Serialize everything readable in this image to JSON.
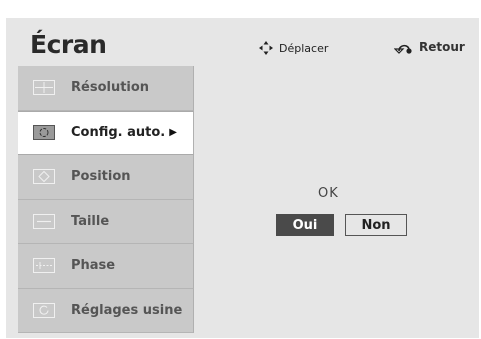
{
  "header": {
    "title": "Écran",
    "move_hint": "Déplacer",
    "move_icon": "four-way-arrows-icon",
    "back_hint": "Retour",
    "back_icon": "return-arrow-icon"
  },
  "menu": {
    "items": [
      {
        "label": "Résolution",
        "icon": "resolution-icon"
      },
      {
        "label": "Config. auto.",
        "icon": "auto-config-icon",
        "selected": true
      },
      {
        "label": "Position",
        "icon": "position-icon"
      },
      {
        "label": "Taille",
        "icon": "size-icon"
      },
      {
        "label": "Phase",
        "icon": "phase-icon"
      },
      {
        "label": "Réglages usine",
        "icon": "factory-reset-icon"
      }
    ],
    "selected_arrow": "▶"
  },
  "dialog": {
    "prompt": "OK",
    "yes_label": "Oui",
    "no_label": "Non"
  },
  "colors": {
    "panel": "#e6e6e6",
    "menu_item": "#c9c9c9",
    "selected_item": "#ffffff",
    "yes_button": "#4a4a4a"
  }
}
